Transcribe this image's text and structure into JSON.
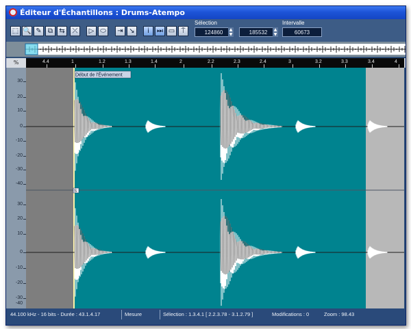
{
  "window": {
    "title": "Éditeur d'Échantillons : Drums-Atempo"
  },
  "toolbar": {
    "tools": [
      {
        "icon": "range-select-icon",
        "glyph": "⬚"
      },
      {
        "icon": "zoom-icon",
        "glyph": "🔍"
      },
      {
        "icon": "pencil-icon",
        "glyph": "✎"
      },
      {
        "icon": "split-icon",
        "glyph": "⧉"
      },
      {
        "icon": "swap-icon",
        "glyph": "⇆"
      },
      {
        "icon": "time-warp-icon",
        "glyph": "⤫"
      },
      {
        "icon": "play-icon",
        "glyph": "▷"
      },
      {
        "icon": "loop-icon",
        "glyph": "⬭"
      },
      {
        "icon": "snap-icon",
        "glyph": "⇥"
      },
      {
        "icon": "zero-crossing-icon",
        "glyph": "↘"
      },
      {
        "icon": "info-icon",
        "glyph": "i"
      },
      {
        "icon": "autoscroll-icon",
        "glyph": "⏭"
      },
      {
        "icon": "region-icon",
        "glyph": "▭"
      },
      {
        "icon": "marker-icon",
        "glyph": "⍑"
      }
    ]
  },
  "selection": {
    "label": "Sélection",
    "start": "124860",
    "end": "185532"
  },
  "interval": {
    "label": "Intervalle",
    "value": "60673"
  },
  "ruler": {
    "corner": "%",
    "ticks": [
      "4.4",
      "1",
      "1.2",
      "1.3",
      "1.4",
      "2",
      "2.2",
      "2.3",
      "2.4",
      "3",
      "3.2",
      "3.3",
      "3.4",
      "4"
    ]
  },
  "event_start_label": "Début de l'Événement",
  "scale": {
    "top": [
      "30",
      "20",
      "10",
      "0",
      "-10",
      "-20",
      "-30",
      "-40"
    ],
    "bottom": [
      "30",
      "20",
      "10",
      "0",
      "-10",
      "-20",
      "-30",
      "-40"
    ]
  },
  "colors": {
    "waveform_background": "#00838f",
    "outside_region": "#7e7e7e",
    "after_region": "#b8b8b8",
    "waveform": "#ffffff",
    "event_start_line": "#fff4a8"
  },
  "status": {
    "format": "44.100 kHz - 16 bits - Durée : 43.1.4.17",
    "mode": "Mesure",
    "selection": "Sélection : 1.3.4.1 [ 2.2.3.78 - 3.1.2.79 ]",
    "modifications": "Modifications : 0",
    "zoom": "Zoom : 98.43"
  }
}
